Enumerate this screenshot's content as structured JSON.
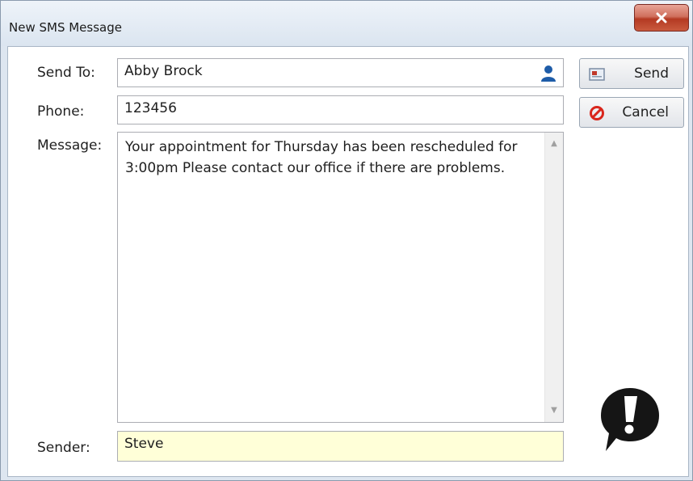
{
  "window": {
    "title": "New SMS Message"
  },
  "labels": {
    "send_to": "Send To:",
    "phone": "Phone:",
    "message": "Message:",
    "sender": "Sender:"
  },
  "fields": {
    "send_to_value": "Abby Brock",
    "phone_value": "123456",
    "message_value": "Your appointment for Thursday has been rescheduled for 3:00pm  Please contact our office if there are problems.",
    "sender_value": "Steve"
  },
  "buttons": {
    "send_label": "Send",
    "cancel_label": "Cancel"
  },
  "icons": {
    "close": "close-icon",
    "contact": "person-icon",
    "send": "send-icon",
    "cancel": "cancel-icon",
    "alert": "exclamation-bubble-icon"
  },
  "colors": {
    "sender_field_bg": "#ffffd8",
    "close_button": "#c95a3e",
    "cancel_icon": "#d9261c",
    "person_icon": "#1e5ca8"
  }
}
